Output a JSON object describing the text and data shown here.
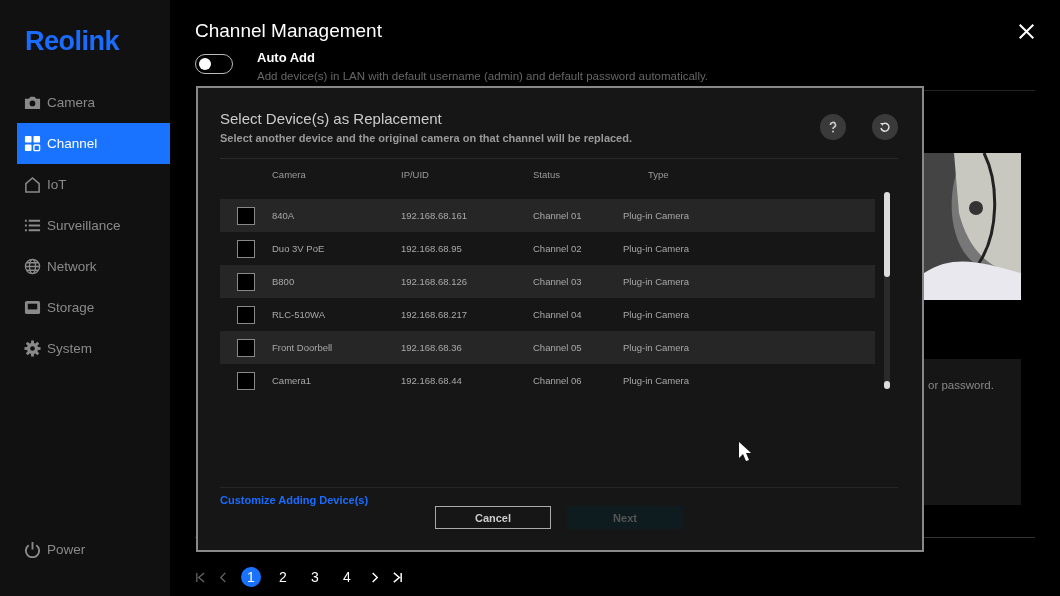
{
  "logo": "Reolink",
  "sidebar": {
    "items": [
      {
        "label": "Camera",
        "kind": "camera",
        "selected": false
      },
      {
        "label": "Channel",
        "kind": "grid",
        "selected": true
      },
      {
        "label": "IoT",
        "kind": "home",
        "selected": false
      },
      {
        "label": "Surveillance",
        "kind": "list",
        "selected": false
      },
      {
        "label": "Network",
        "kind": "globe",
        "selected": false
      },
      {
        "label": "Storage",
        "kind": "disk",
        "selected": false
      },
      {
        "label": "System",
        "kind": "gear",
        "selected": false
      }
    ],
    "power": "Power"
  },
  "page": {
    "title": "Channel Management",
    "auto_add": {
      "label": "Auto Add",
      "description": "Add device(s) in LAN with default username (admin) and default password automatically.",
      "on": false
    },
    "hint_fragment": "or password."
  },
  "pagination": {
    "pages": [
      {
        "label": "1",
        "selected": true
      },
      {
        "label": "2",
        "selected": false
      },
      {
        "label": "3",
        "selected": false
      },
      {
        "label": "4",
        "selected": false
      }
    ]
  },
  "dialog": {
    "title": "Select Device(s) as Replacement",
    "subtitle": "Select another device and the original camera on that channel will be replaced.",
    "columns": [
      "Camera",
      "IP/UID",
      "Status",
      "Type"
    ],
    "rows": [
      {
        "camera": "840A",
        "ip": "192.168.68.161",
        "status": "Channel 01",
        "type": "Plug-in Camera",
        "checked": false
      },
      {
        "camera": "Duo 3V PoE",
        "ip": "192.168.68.95",
        "status": "Channel 02",
        "type": "Plug-in Camera",
        "checked": false
      },
      {
        "camera": "B800",
        "ip": "192.168.68.126",
        "status": "Channel 03",
        "type": "Plug-in Camera",
        "checked": false
      },
      {
        "camera": "RLC-510WA",
        "ip": "192.168.68.217",
        "status": "Channel 04",
        "type": "Plug-in Camera",
        "checked": false
      },
      {
        "camera": "Front Doorbell",
        "ip": "192.168.68.36",
        "status": "Channel 05",
        "type": "Plug-in Camera",
        "checked": false
      },
      {
        "camera": "Camera1",
        "ip": "192.168.68.44",
        "status": "Channel 06",
        "type": "Plug-in Camera",
        "checked": false
      }
    ],
    "link": "Customize Adding Device(s)",
    "buttons": [
      {
        "label": "Cancel",
        "disabled": false
      },
      {
        "label": "Next",
        "disabled": true
      }
    ]
  }
}
